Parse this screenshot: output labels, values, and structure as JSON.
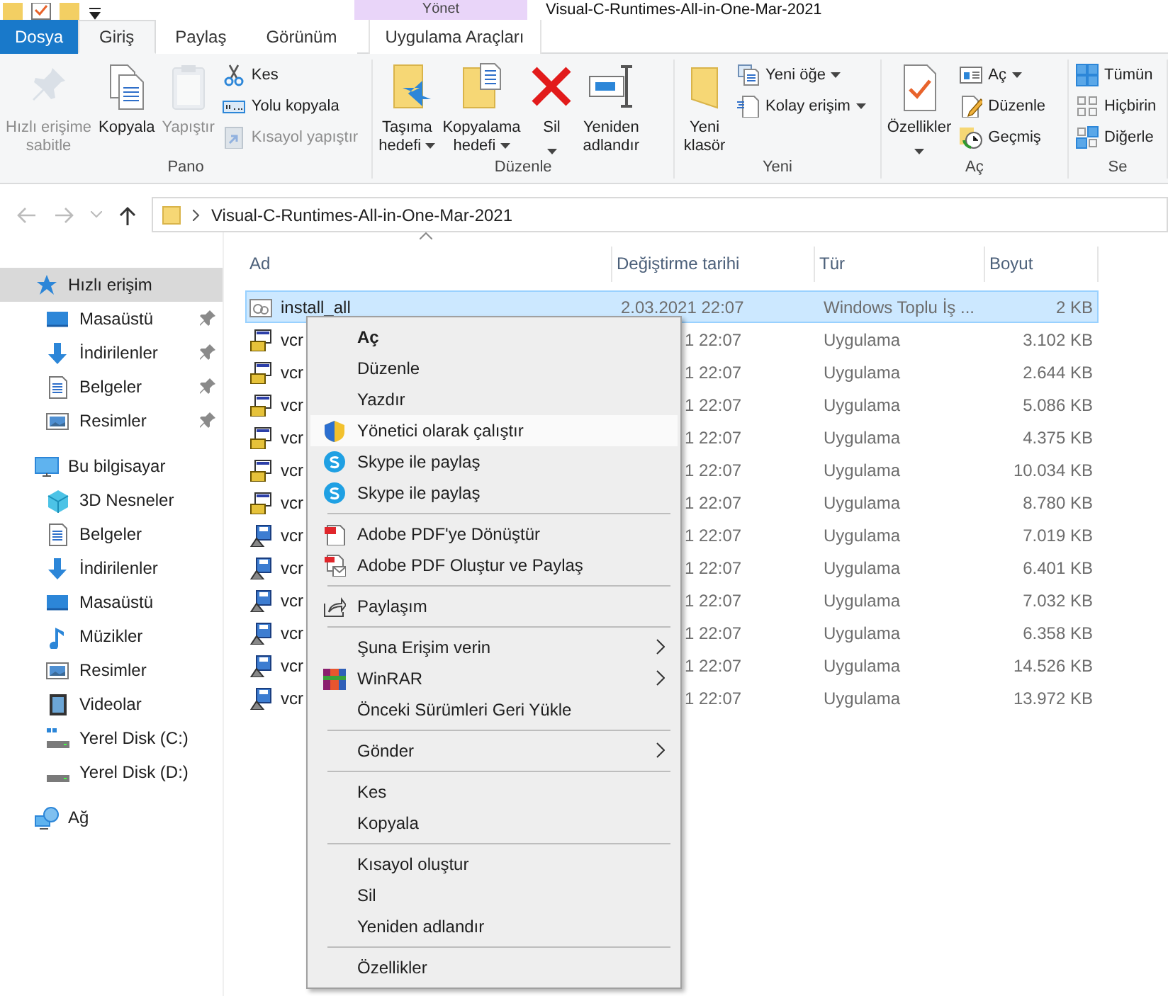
{
  "title_bar": {
    "context_header": "Yönet",
    "title": "Visual-C-Runtimes-All-in-One-Mar-2021"
  },
  "ribbon_tabs": [
    {
      "label": "Dosya",
      "kind": "file",
      "selected": false
    },
    {
      "label": "Giriş",
      "kind": "tab",
      "selected": true
    },
    {
      "label": "Paylaş",
      "kind": "tab",
      "selected": false
    },
    {
      "label": "Görünüm",
      "kind": "tab",
      "selected": false
    },
    {
      "label": "Uygulama Araçları",
      "kind": "context",
      "selected": false
    }
  ],
  "ribbon_groups": [
    {
      "label": "Pano",
      "commands": [
        {
          "kind": "large",
          "lines": [
            "Hızlı erişime",
            "sabitle"
          ],
          "disabled": true,
          "dropdown": false
        },
        {
          "kind": "large",
          "lines": [
            "Kopyala"
          ],
          "disabled": false,
          "dropdown": false
        },
        {
          "kind": "large",
          "lines": [
            "Yapıştır"
          ],
          "disabled": true,
          "dropdown": false
        },
        {
          "kind": "small",
          "lines": [
            "Kes"
          ],
          "disabled": false,
          "dropdown": false
        },
        {
          "kind": "small",
          "lines": [
            "Yolu kopyala"
          ],
          "disabled": false,
          "dropdown": false
        },
        {
          "kind": "small",
          "lines": [
            "Kısayol yapıştır"
          ],
          "disabled": true,
          "dropdown": false
        }
      ]
    },
    {
      "label": "Düzenle",
      "commands": [
        {
          "kind": "large",
          "lines": [
            "Taşıma",
            "hedefi"
          ],
          "disabled": false,
          "dropdown": true
        },
        {
          "kind": "large",
          "lines": [
            "Kopyalama",
            "hedefi"
          ],
          "disabled": false,
          "dropdown": true
        },
        {
          "kind": "large",
          "lines": [
            "Sil"
          ],
          "disabled": false,
          "dropdown": true
        },
        {
          "kind": "large",
          "lines": [
            "Yeniden",
            "adlandır"
          ],
          "disabled": false,
          "dropdown": false
        }
      ]
    },
    {
      "label": "Yeni",
      "commands": [
        {
          "kind": "large",
          "lines": [
            "Yeni",
            "klasör"
          ],
          "disabled": false,
          "dropdown": false
        },
        {
          "kind": "small",
          "lines": [
            "Yeni öğe"
          ],
          "disabled": false,
          "dropdown": true
        },
        {
          "kind": "small",
          "lines": [
            "Kolay erişim"
          ],
          "disabled": false,
          "dropdown": true
        }
      ]
    },
    {
      "label": "Aç",
      "commands": [
        {
          "kind": "large",
          "lines": [
            "Özellikler"
          ],
          "disabled": false,
          "dropdown": true
        },
        {
          "kind": "small",
          "lines": [
            "Aç"
          ],
          "disabled": false,
          "dropdown": true
        },
        {
          "kind": "small",
          "lines": [
            "Düzenle"
          ],
          "disabled": false,
          "dropdown": false
        },
        {
          "kind": "small",
          "lines": [
            "Geçmiş"
          ],
          "disabled": false,
          "dropdown": false
        }
      ]
    },
    {
      "label": "Se",
      "commands": [
        {
          "kind": "small",
          "lines": [
            "Tümün"
          ],
          "disabled": false,
          "dropdown": false
        },
        {
          "kind": "small",
          "lines": [
            "Hiçbirin"
          ],
          "disabled": false,
          "dropdown": false
        },
        {
          "kind": "small",
          "lines": [
            "Diğerle"
          ],
          "disabled": false,
          "dropdown": false
        }
      ]
    }
  ],
  "address_bar": {
    "path": "Visual-C-Runtimes-All-in-One-Mar-2021"
  },
  "navigation": [
    {
      "label": "Hızlı erişim",
      "kind": "star",
      "selected": true,
      "children": [
        {
          "label": "Masaüstü",
          "kind": "desktop",
          "pinned": true,
          "selected": false
        },
        {
          "label": "İndirilenler",
          "kind": "download",
          "pinned": true,
          "selected": false
        },
        {
          "label": "Belgeler",
          "kind": "documents",
          "pinned": true,
          "selected": false
        },
        {
          "label": "Resimler",
          "kind": "pictures",
          "pinned": true,
          "selected": false
        }
      ]
    },
    {
      "label": "Bu bilgisayar",
      "kind": "computer",
      "selected": false,
      "children": [
        {
          "label": "3D Nesneler",
          "kind": "cube",
          "pinned": false,
          "selected": false
        },
        {
          "label": "Belgeler",
          "kind": "documents",
          "pinned": false,
          "selected": false
        },
        {
          "label": "İndirilenler",
          "kind": "download",
          "pinned": false,
          "selected": false
        },
        {
          "label": "Masaüstü",
          "kind": "desktop",
          "pinned": false,
          "selected": false
        },
        {
          "label": "Müzikler",
          "kind": "music",
          "pinned": false,
          "selected": false
        },
        {
          "label": "Resimler",
          "kind": "pictures",
          "pinned": false,
          "selected": false
        },
        {
          "label": "Videolar",
          "kind": "video",
          "pinned": false,
          "selected": false
        },
        {
          "label": "Yerel Disk (C:)",
          "kind": "system-drive",
          "pinned": false,
          "selected": false
        },
        {
          "label": "Yerel Disk (D:)",
          "kind": "drive",
          "pinned": false,
          "selected": false
        }
      ]
    },
    {
      "label": "Ağ",
      "kind": "network",
      "selected": false
    }
  ],
  "file_list": {
    "columns": [
      "Ad",
      "Değiştirme tarihi",
      "Tür",
      "Boyut"
    ],
    "rows": [
      {
        "name": "install_all",
        "modified": "2.03.2021 22:07",
        "type": "Windows Toplu İş ...",
        "size": "2 KB",
        "kind": "batch",
        "selected": true
      },
      {
        "name": "vcr",
        "modified": "1 22:07",
        "type": "Uygulama",
        "size": "3.102 KB",
        "kind": "setup",
        "selected": false
      },
      {
        "name": "vcr",
        "modified": "1 22:07",
        "type": "Uygulama",
        "size": "2.644 KB",
        "kind": "setup",
        "selected": false
      },
      {
        "name": "vcr",
        "modified": "1 22:07",
        "type": "Uygulama",
        "size": "5.086 KB",
        "kind": "setup",
        "selected": false
      },
      {
        "name": "vcr",
        "modified": "1 22:07",
        "type": "Uygulama",
        "size": "4.375 KB",
        "kind": "setup",
        "selected": false
      },
      {
        "name": "vcr",
        "modified": "1 22:07",
        "type": "Uygulama",
        "size": "10.034 KB",
        "kind": "setup",
        "selected": false
      },
      {
        "name": "vcr",
        "modified": "1 22:07",
        "type": "Uygulama",
        "size": "8.780 KB",
        "kind": "setup",
        "selected": false
      },
      {
        "name": "vcr",
        "modified": "1 22:07",
        "type": "Uygulama",
        "size": "7.019 KB",
        "kind": "installer",
        "selected": false
      },
      {
        "name": "vcr",
        "modified": "1 22:07",
        "type": "Uygulama",
        "size": "6.401 KB",
        "kind": "installer",
        "selected": false
      },
      {
        "name": "vcr",
        "modified": "1 22:07",
        "type": "Uygulama",
        "size": "7.032 KB",
        "kind": "installer",
        "selected": false
      },
      {
        "name": "vcr",
        "modified": "1 22:07",
        "type": "Uygulama",
        "size": "6.358 KB",
        "kind": "installer",
        "selected": false
      },
      {
        "name": "vcr",
        "modified": "1 22:07",
        "type": "Uygulama",
        "size": "14.526 KB",
        "kind": "installer",
        "selected": false
      },
      {
        "name": "vcr",
        "modified": "1 22:07",
        "type": "Uygulama",
        "size": "13.972 KB",
        "kind": "installer",
        "selected": false
      }
    ]
  },
  "context_menu": {
    "sections": [
      [
        {
          "label": "Aç",
          "kind": "plain",
          "default": true,
          "selected": false,
          "submenu": false
        },
        {
          "label": "Düzenle",
          "kind": "plain",
          "default": false,
          "selected": false,
          "submenu": false
        },
        {
          "label": "Yazdır",
          "kind": "plain",
          "default": false,
          "selected": false,
          "submenu": false
        },
        {
          "label": "Yönetici olarak çalıştır",
          "kind": "shield",
          "default": false,
          "selected": true,
          "submenu": false
        },
        {
          "label": "Skype ile paylaş",
          "kind": "skype",
          "default": false,
          "selected": false,
          "submenu": false
        },
        {
          "label": "Skype ile paylaş",
          "kind": "skype",
          "default": false,
          "selected": false,
          "submenu": false
        }
      ],
      [
        {
          "label": "Adobe PDF'ye Dönüştür",
          "kind": "pdf",
          "default": false,
          "selected": false,
          "submenu": false
        },
        {
          "label": "Adobe PDF Oluştur ve Paylaş",
          "kind": "pdf-mail",
          "default": false,
          "selected": false,
          "submenu": false
        }
      ],
      [
        {
          "label": "Paylaşım",
          "kind": "share",
          "default": false,
          "selected": false,
          "submenu": false
        }
      ],
      [
        {
          "label": "Şuna Erişim verin",
          "kind": "plain",
          "default": false,
          "selected": false,
          "submenu": true
        },
        {
          "label": "WinRAR",
          "kind": "winrar",
          "default": false,
          "selected": false,
          "submenu": true
        },
        {
          "label": "Önceki Sürümleri Geri Yükle",
          "kind": "plain",
          "default": false,
          "selected": false,
          "submenu": false
        }
      ],
      [
        {
          "label": "Gönder",
          "kind": "plain",
          "default": false,
          "selected": false,
          "submenu": true
        }
      ],
      [
        {
          "label": "Kes",
          "kind": "plain",
          "default": false,
          "selected": false,
          "submenu": false
        },
        {
          "label": "Kopyala",
          "kind": "plain",
          "default": false,
          "selected": false,
          "submenu": false
        }
      ],
      [
        {
          "label": "Kısayol oluştur",
          "kind": "plain",
          "default": false,
          "selected": false,
          "submenu": false
        },
        {
          "label": "Sil",
          "kind": "plain",
          "default": false,
          "selected": false,
          "submenu": false
        },
        {
          "label": "Yeniden adlandır",
          "kind": "plain",
          "default": false,
          "selected": false,
          "submenu": false
        }
      ],
      [
        {
          "label": "Özellikler",
          "kind": "plain",
          "default": false,
          "selected": false,
          "submenu": false
        }
      ]
    ]
  }
}
